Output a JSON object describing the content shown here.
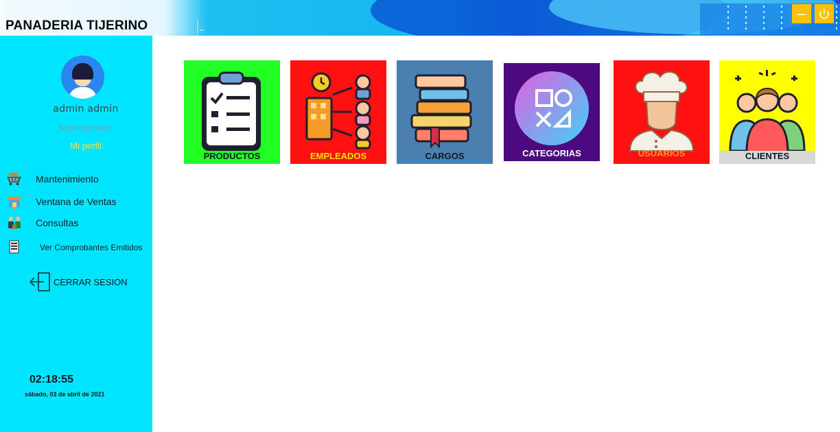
{
  "app": {
    "title": "PANADERIA TIJERINO",
    "window_controls": [
      "minimize-icon",
      "power-icon"
    ],
    "accent": "#ffc107"
  },
  "user": {
    "name": "admin admin",
    "role": "Administrador",
    "profile_link": "Mi perfil"
  },
  "sidebar": {
    "background": "#00e5ff",
    "items": [
      {
        "label": "Mantenimiento",
        "icon": "cart-icon"
      },
      {
        "label": "Ventana de Ventas",
        "icon": "store-icon"
      },
      {
        "label": "Consultas",
        "icon": "people-icon"
      },
      {
        "label": "Ver Comprobantes Emitidos",
        "icon": "receipt-icon"
      }
    ],
    "logout": {
      "label": "CERRAR SESION",
      "icon": "logout-icon"
    }
  },
  "clock": {
    "time": "02:18:55",
    "date": "sábado, 03 de abril de 2021"
  },
  "tiles": [
    {
      "label": "PRODUCTOS",
      "icon": "clipboard-checklist-icon",
      "color": "#22ff22"
    },
    {
      "label": "EMPLEADOS",
      "icon": "workflow-people-icon",
      "color": "#ff1111"
    },
    {
      "label": "CARGOS",
      "icon": "books-stack-icon",
      "color": "#4a7fb0"
    },
    {
      "label": "CATEGORIAS",
      "icon": "shapes-icon",
      "color": "#4d0a80"
    },
    {
      "label": "USUARIOS",
      "icon": "chef-icon",
      "color": "#ff1111"
    },
    {
      "label": "CLIENTES",
      "icon": "group-people-icon",
      "color": "#ffff00"
    }
  ]
}
